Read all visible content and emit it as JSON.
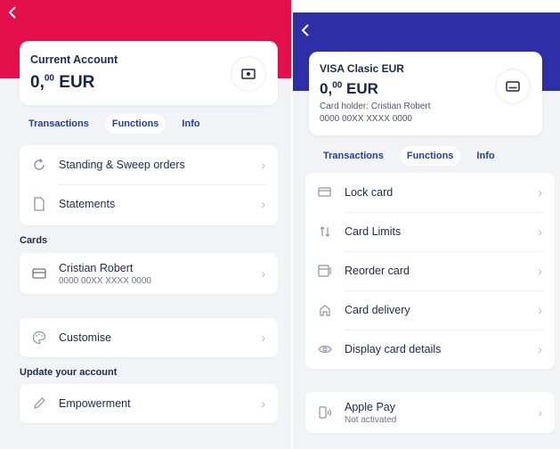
{
  "left": {
    "header_color": "#e3104c",
    "back_icon": "chevron-left-icon",
    "account": {
      "title": "Current Account",
      "balance_int": "0,",
      "balance_dec": "00",
      "currency": "EUR",
      "icon": "banknote-icon"
    },
    "tabs": [
      "Transactions",
      "Functions",
      "Info"
    ],
    "active_tab": "Functions",
    "menu": [
      {
        "label": "Standing & Sweep orders",
        "icon": "refresh-icon"
      },
      {
        "label": "Statements",
        "icon": "document-icon"
      }
    ],
    "cards_section": {
      "title": "Cards",
      "card_holder": "Cristian Robert",
      "card_number": "0000 00XX XXXX 0000",
      "icon": "credit-card-icon"
    },
    "customise": {
      "label": "Customise",
      "icon": "palette-icon"
    },
    "update_section": {
      "title": "Update your account",
      "item_label": "Empowerment",
      "icon": "pencil-icon"
    }
  },
  "right": {
    "header_color": "#2e2ea6",
    "back_icon": "chevron-left-icon",
    "account": {
      "title": "VISA Clasic EUR",
      "balance_int": "0,",
      "balance_dec": "00",
      "currency": "EUR",
      "holder": "Card holder: Cristian Robert",
      "number": "0000 00XX XXXX 0000",
      "icon": "card-icon"
    },
    "tabs": [
      "Transactions",
      "Functions",
      "Info"
    ],
    "active_tab": "Functions",
    "menu": [
      {
        "label": "Lock card",
        "icon": "lock-card-icon"
      },
      {
        "label": "Card Limits",
        "icon": "arrows-up-down-icon"
      },
      {
        "label": "Reorder card",
        "icon": "reorder-card-icon"
      },
      {
        "label": "Card delivery",
        "icon": "home-icon"
      },
      {
        "label": "Display card details",
        "icon": "eye-icon"
      }
    ],
    "apple_pay": {
      "label": "Apple Pay",
      "status": "Not activated",
      "icon": "contactless-phone-icon"
    }
  }
}
